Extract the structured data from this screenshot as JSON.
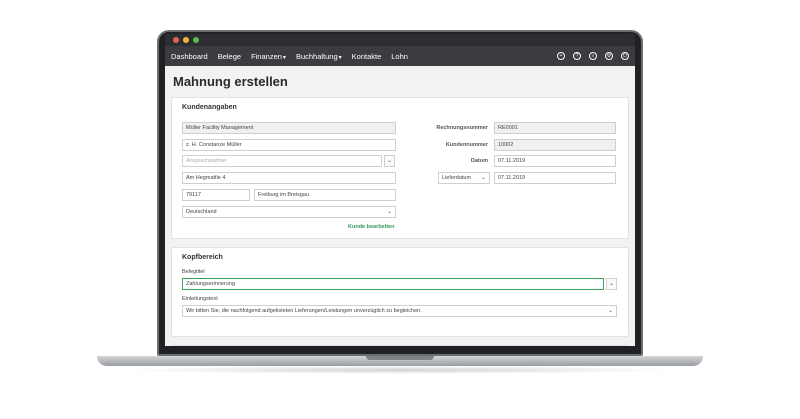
{
  "window": {
    "traffic_lights": [
      "close",
      "minimize",
      "maximize"
    ]
  },
  "nav": {
    "items": [
      {
        "label": "Dashboard"
      },
      {
        "label": "Belege"
      },
      {
        "label": "Finanzen",
        "dropdown": true
      },
      {
        "label": "Buchhaltung",
        "dropdown": true
      },
      {
        "label": "Kontakte"
      },
      {
        "label": "Lohn"
      }
    ],
    "icons": [
      "plus-icon",
      "help-icon",
      "search-icon",
      "settings-icon",
      "power-icon"
    ]
  },
  "page": {
    "title": "Mahnung erstellen"
  },
  "customer": {
    "section_title": "Kundenangaben",
    "company": "Müller Facility Management",
    "contact_line": "z. H. Constanze Müller",
    "contact_person_placeholder": "Ansprechpartner",
    "street": "Am Hegmattle 4",
    "zip": "79117",
    "city": "Freiburg im Breisgau",
    "country": "Deutschland",
    "edit_link": "Kunde bearbeiten"
  },
  "invoice": {
    "number_label": "Rechnungsnummer",
    "number_value": "RE0001",
    "customer_no_label": "Kundennummer",
    "customer_no_value": "10002",
    "date_label": "Datum",
    "date_value": "07.11.2019",
    "delivery_select_label": "Lieferdatum",
    "delivery_date_value": "07.11.2019"
  },
  "header_section": {
    "section_title": "Kopfbereich",
    "doc_title_label": "Belegtitel",
    "doc_title_value": "Zahlungserinnerung",
    "intro_label": "Einleitungstext",
    "intro_value": "Wir bitten Sie, die nachfolgend aufgelisteten Lieferungen/Leistungen unverzüglich zu begleichen."
  },
  "colors": {
    "accent": "#2f9a55",
    "navbar": "#3a3c40"
  }
}
